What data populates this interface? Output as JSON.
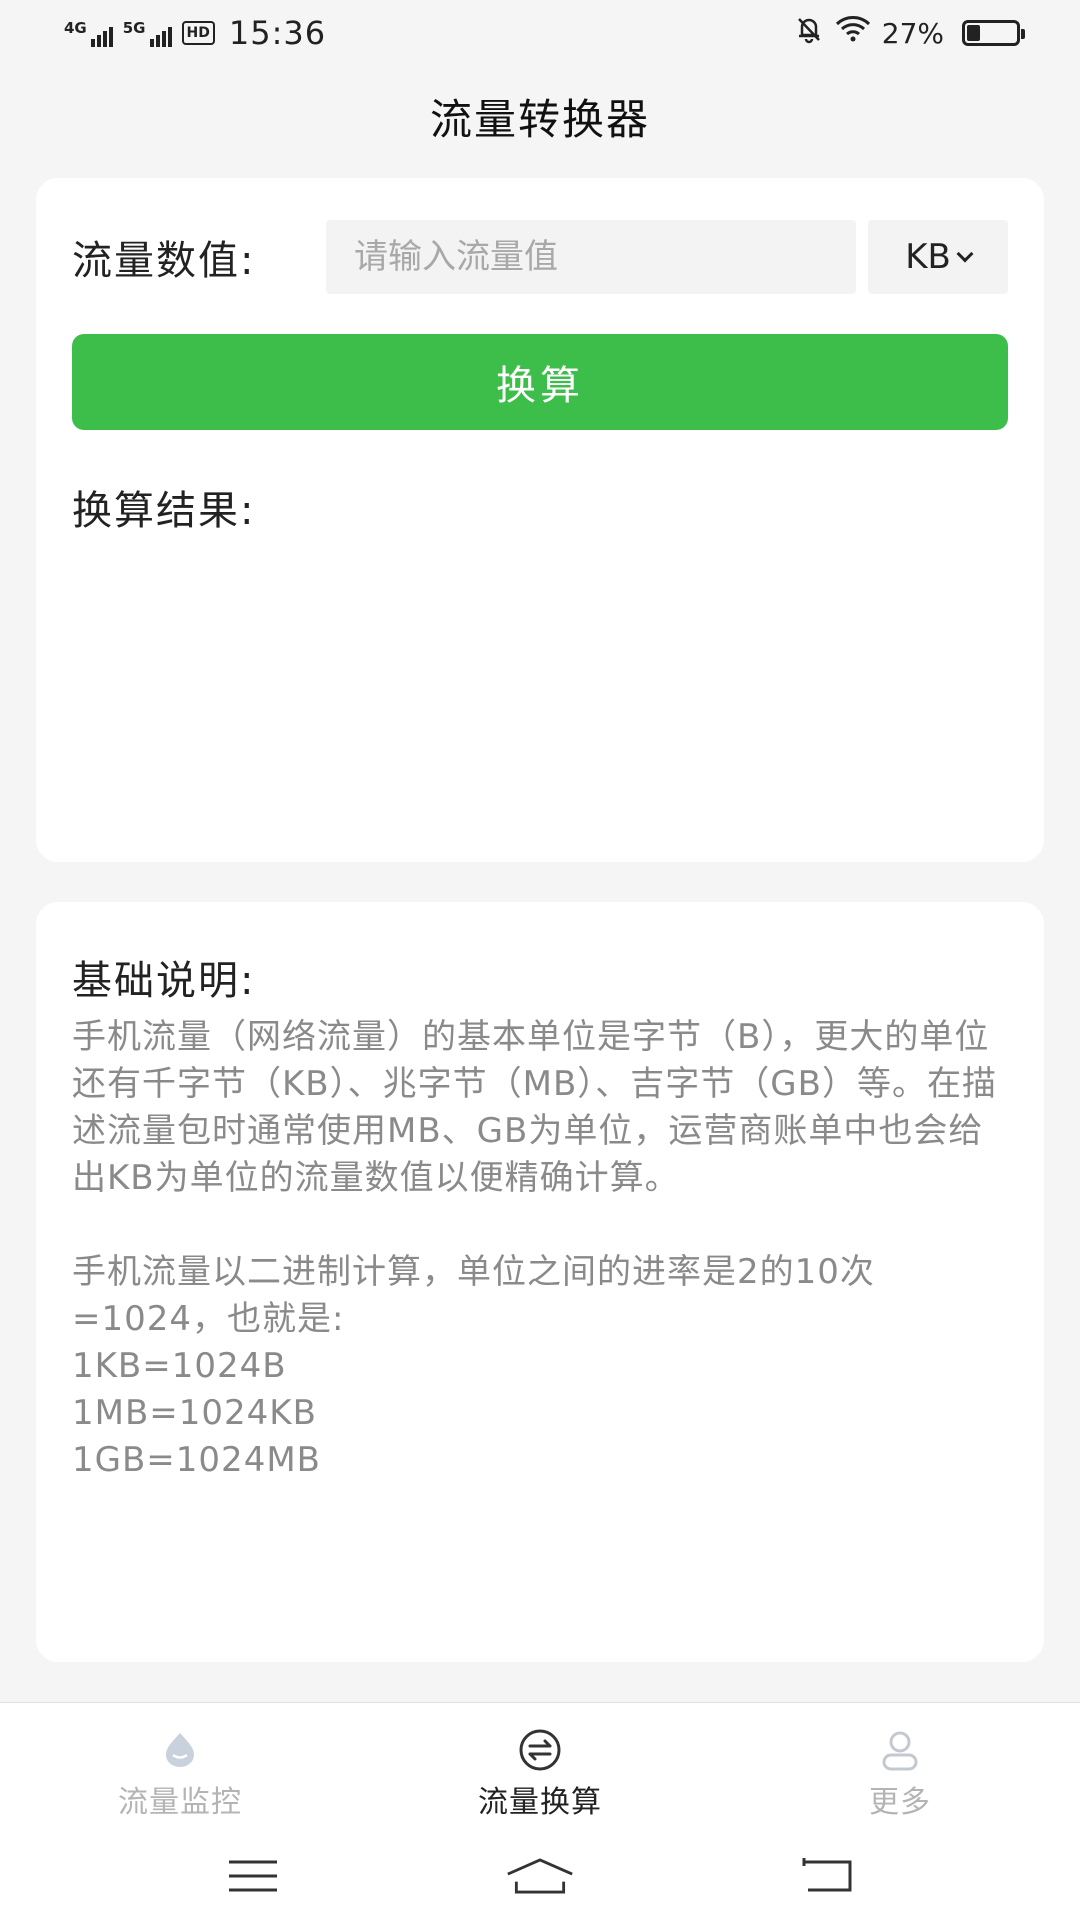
{
  "status_bar": {
    "signal_1": "4G",
    "signal_2": "5G",
    "hd": "HD",
    "time": "15:36",
    "battery_pct": "27%",
    "battery_level": 0.27,
    "icons": [
      "mute-bell-icon",
      "wifi-icon",
      "battery-icon"
    ]
  },
  "header": {
    "title": "流量转换器"
  },
  "converter": {
    "value_label": "流量数值:",
    "input_value": "",
    "input_placeholder": "请输入流量值",
    "unit_selected": "KB",
    "convert_label": "换算",
    "result_label": "换算结果:",
    "result_value": ""
  },
  "info": {
    "title": "基础说明:",
    "paragraph_1": "手机流量（网络流量）的基本单位是字节（B），更大的单位还有千字节（KB）、兆字节（MB）、吉字节（GB）等。在描述流量包时通常使用MB、GB为单位，运营商账单中也会给出KB为单位的流量数值以便精确计算。",
    "paragraph_2": "手机流量以二进制计算，单位之间的进率是2的10次=1024，也就是:\n1KB=1024B\n1MB=1024KB\n1GB=1024MB"
  },
  "bottom_nav": {
    "items": [
      {
        "label": "流量监控",
        "icon": "droplet-icon",
        "active": false
      },
      {
        "label": "流量换算",
        "icon": "convert-arrows-icon",
        "active": true
      },
      {
        "label": "更多",
        "icon": "person-icon",
        "active": false
      }
    ]
  },
  "colors": {
    "accent": "#3dbd4a",
    "inactive": "#b4b4b4",
    "background": "#f5f5f5"
  }
}
